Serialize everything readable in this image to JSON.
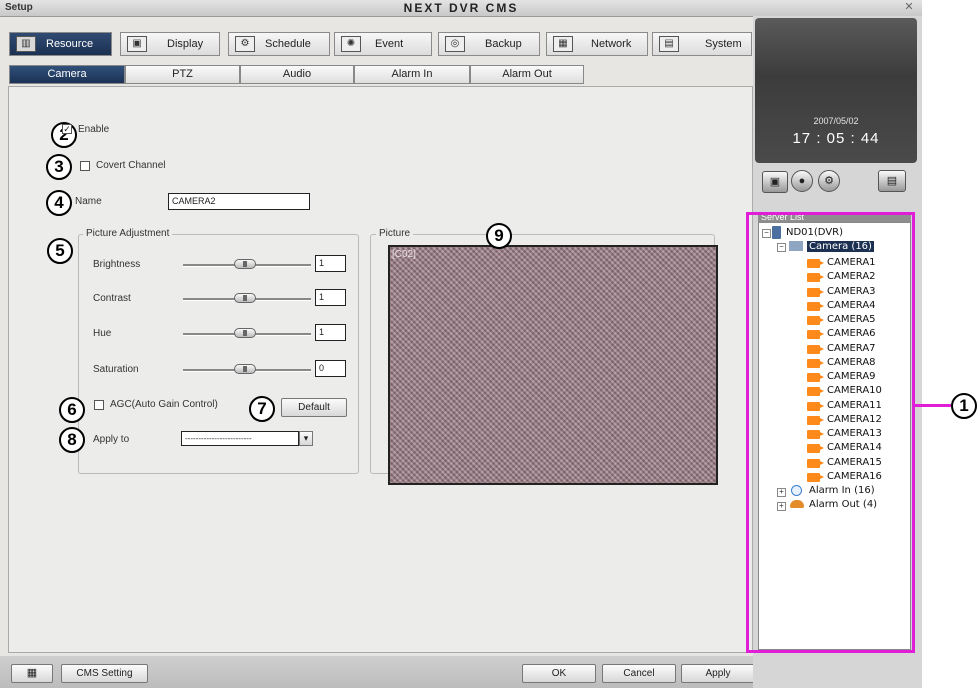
{
  "window": {
    "left_title": "Setup",
    "center_title": "NEXT DVR CMS",
    "close": "✕"
  },
  "main_tabs": [
    {
      "label": "Resource",
      "icon": "▥"
    },
    {
      "label": "Display",
      "icon": "▣"
    },
    {
      "label": "Schedule",
      "icon": "⚙"
    },
    {
      "label": "Event",
      "icon": "✺"
    },
    {
      "label": "Backup",
      "icon": "◎"
    },
    {
      "label": "Network",
      "icon": "▦"
    },
    {
      "label": "System",
      "icon": "▤"
    }
  ],
  "sub_tabs": [
    "Camera",
    "PTZ",
    "Audio",
    "Alarm In",
    "Alarm Out"
  ],
  "markers": [
    "1",
    "2",
    "3",
    "4",
    "5",
    "6",
    "7",
    "8",
    "9"
  ],
  "form": {
    "enable_label": "Enable",
    "enable_checked": "✓",
    "covert_label": "Covert Channel",
    "name_label": "Name",
    "name_value": "CAMERA2",
    "picture_adjustment_title": "Picture Adjustment",
    "brightness_label": "Brightness",
    "brightness_value": "1",
    "contrast_label": "Contrast",
    "contrast_value": "1",
    "hue_label": "Hue",
    "hue_value": "1",
    "saturation_label": "Saturation",
    "saturation_value": "0",
    "agc_label": "AGC(Auto Gain Control)",
    "default_button": "Default",
    "apply_to_label": "Apply to",
    "apply_to_value": "-------------------------",
    "dropdown_arrow": "▾",
    "picture_title": "Picture",
    "picture_overlay": "[C02]"
  },
  "clock": {
    "date": "2007/05/02",
    "time": "17 : 05 : 44"
  },
  "server_list": {
    "title": "Server List",
    "root": "ND01(DVR)",
    "camera_group": "Camera (16)",
    "cameras": [
      "CAMERA1",
      "CAMERA2",
      "CAMERA3",
      "CAMERA4",
      "CAMERA5",
      "CAMERA6",
      "CAMERA7",
      "CAMERA8",
      "CAMERA9",
      "CAMERA10",
      "CAMERA11",
      "CAMERA12",
      "CAMERA13",
      "CAMERA14",
      "CAMERA15",
      "CAMERA16"
    ],
    "alarm_in": "Alarm In (16)",
    "alarm_out": "Alarm Out (4)",
    "minus": "−",
    "plus": "+"
  },
  "bottom": {
    "keyboard_icon": "▦",
    "cms_setting": "CMS Setting",
    "ok": "OK",
    "cancel": "Cancel",
    "apply": "Apply"
  },
  "colors": {
    "accent": "#1c3152",
    "marker_line": "#e01ed8"
  }
}
